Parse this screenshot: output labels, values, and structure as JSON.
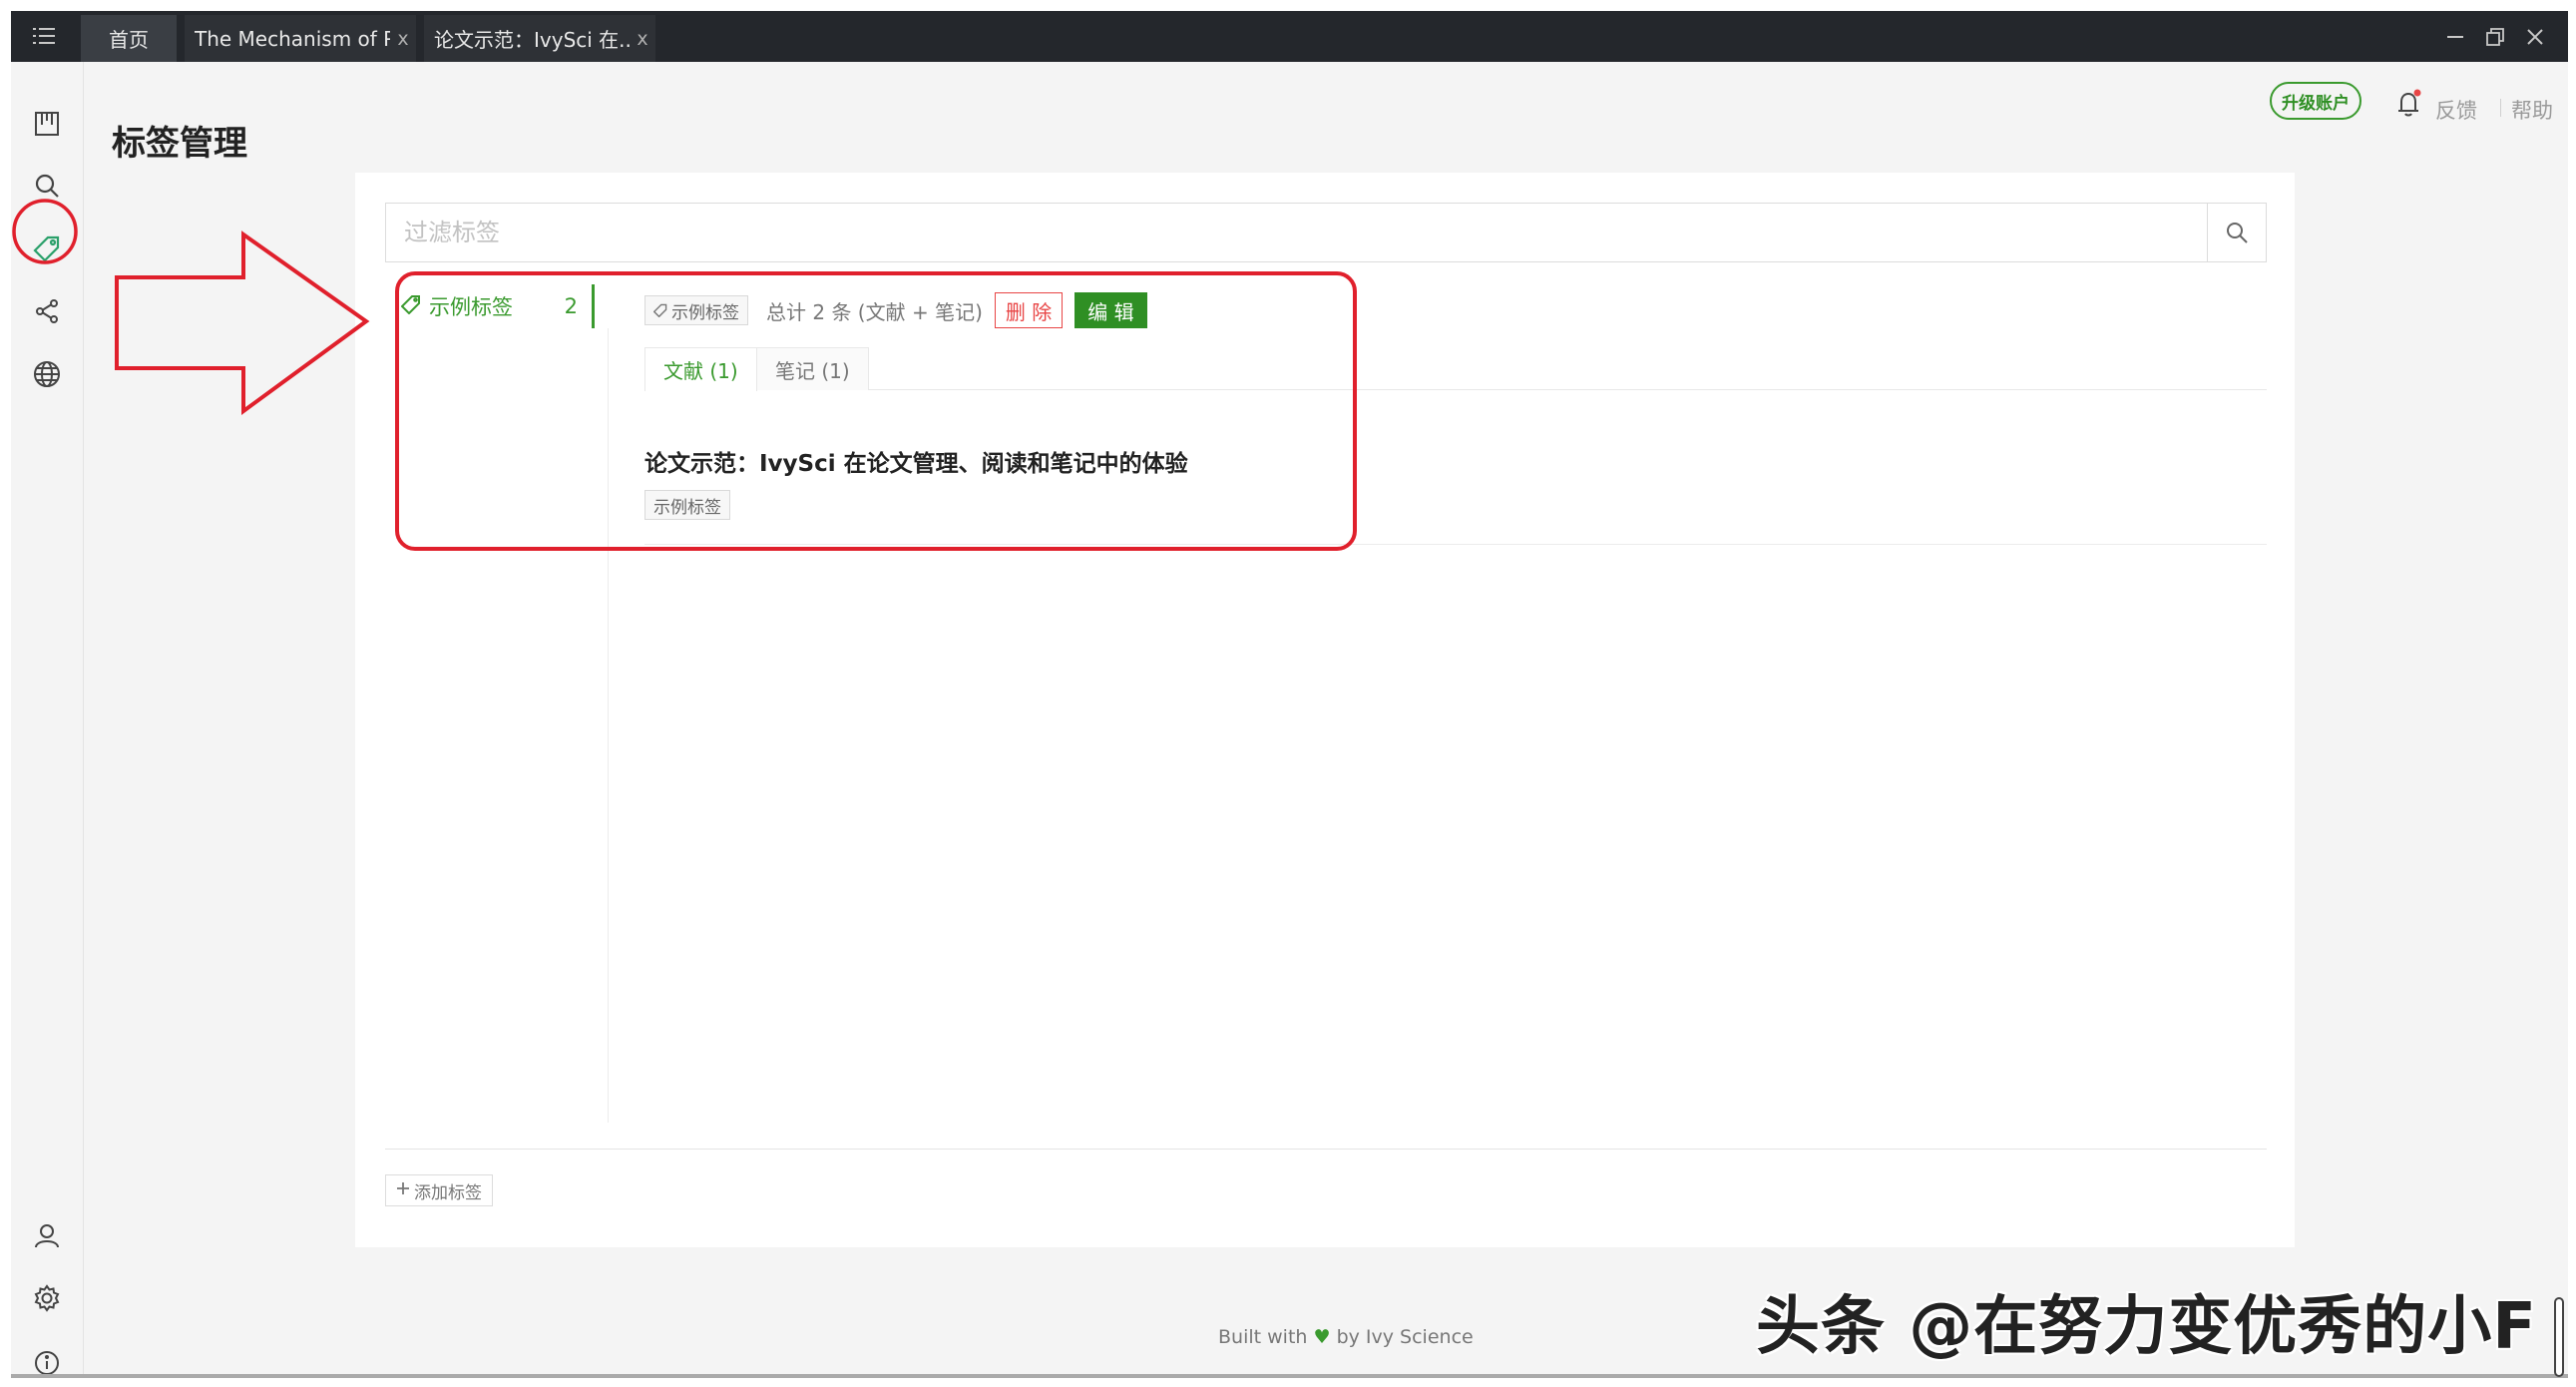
{
  "tabs": [
    {
      "label": "首页"
    },
    {
      "label": "The Mechanism of Pi...",
      "close": "x"
    },
    {
      "label": "论文示范：IvySci 在...",
      "close": "x"
    }
  ],
  "header": {
    "upgrade_label": "升级账户",
    "feedback_label": "反馈",
    "help_label": "帮助"
  },
  "page": {
    "title": "标签管理"
  },
  "filter": {
    "placeholder": "过滤标签",
    "value": ""
  },
  "tags": [
    {
      "name": "示例标签",
      "count": "2"
    }
  ],
  "detail": {
    "tag_chip": "示例标签",
    "total": "总计 2 条 (文献 + 笔记)",
    "delete_label": "删 除",
    "edit_label": "编 辑",
    "sub_tabs": [
      {
        "label": "文献 (1)"
      },
      {
        "label": "笔记 (1)"
      }
    ],
    "items": [
      {
        "title": "论文示范：IvySci 在论文管理、阅读和笔记中的体验",
        "tag": "示例标签"
      }
    ]
  },
  "add_tag_label": "添加标签",
  "footer": {
    "built_prefix": "Built with",
    "built_suffix": "by Ivy Science"
  },
  "watermark": "头条 @在努力变优秀的小F",
  "colors": {
    "accent": "#3a9a2e",
    "danger": "#e84545",
    "annotation": "#e0202c",
    "titlebar": "#24272c"
  }
}
